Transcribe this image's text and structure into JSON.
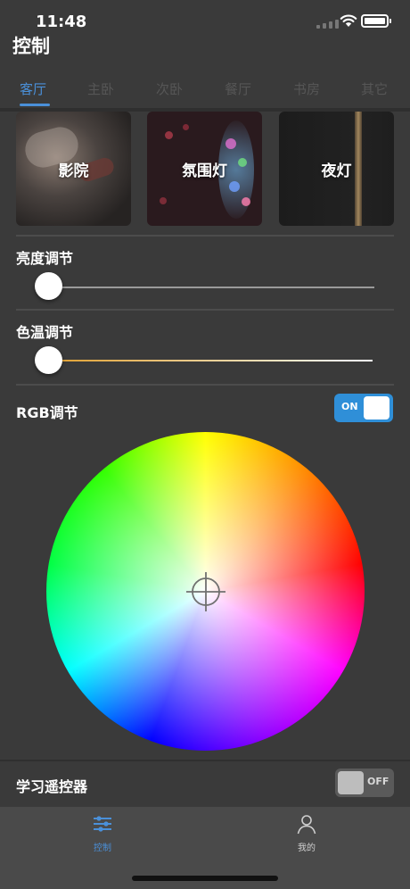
{
  "status": {
    "time": "11:48"
  },
  "header": {
    "title": "控制"
  },
  "tabs": [
    {
      "label": "客厅",
      "active": true
    },
    {
      "label": "主卧",
      "active": false
    },
    {
      "label": "次卧",
      "active": false
    },
    {
      "label": "餐厅",
      "active": false
    },
    {
      "label": "书房",
      "active": false
    },
    {
      "label": "其它",
      "active": false
    }
  ],
  "scenes": [
    {
      "label": "影院"
    },
    {
      "label": "氛围灯"
    },
    {
      "label": "夜灯"
    }
  ],
  "brightness": {
    "label": "亮度调节",
    "value": 0
  },
  "color_temperature": {
    "label": "色温调节",
    "value": 0
  },
  "rgb": {
    "label": "RGB调节",
    "toggle_text": "ON",
    "enabled": true
  },
  "learn_remote": {
    "label": "学习遥控器",
    "toggle_text": "OFF",
    "enabled": false
  },
  "tabbar": [
    {
      "label": "控制",
      "icon": "sliders-icon",
      "active": true
    },
    {
      "label": "我的",
      "icon": "person-icon",
      "active": false
    }
  ],
  "colors": {
    "accent": "#4a90d9",
    "toggle_on": "#2f8fd8",
    "warm_track": "#e0a030",
    "background": "#3a3a3a"
  }
}
